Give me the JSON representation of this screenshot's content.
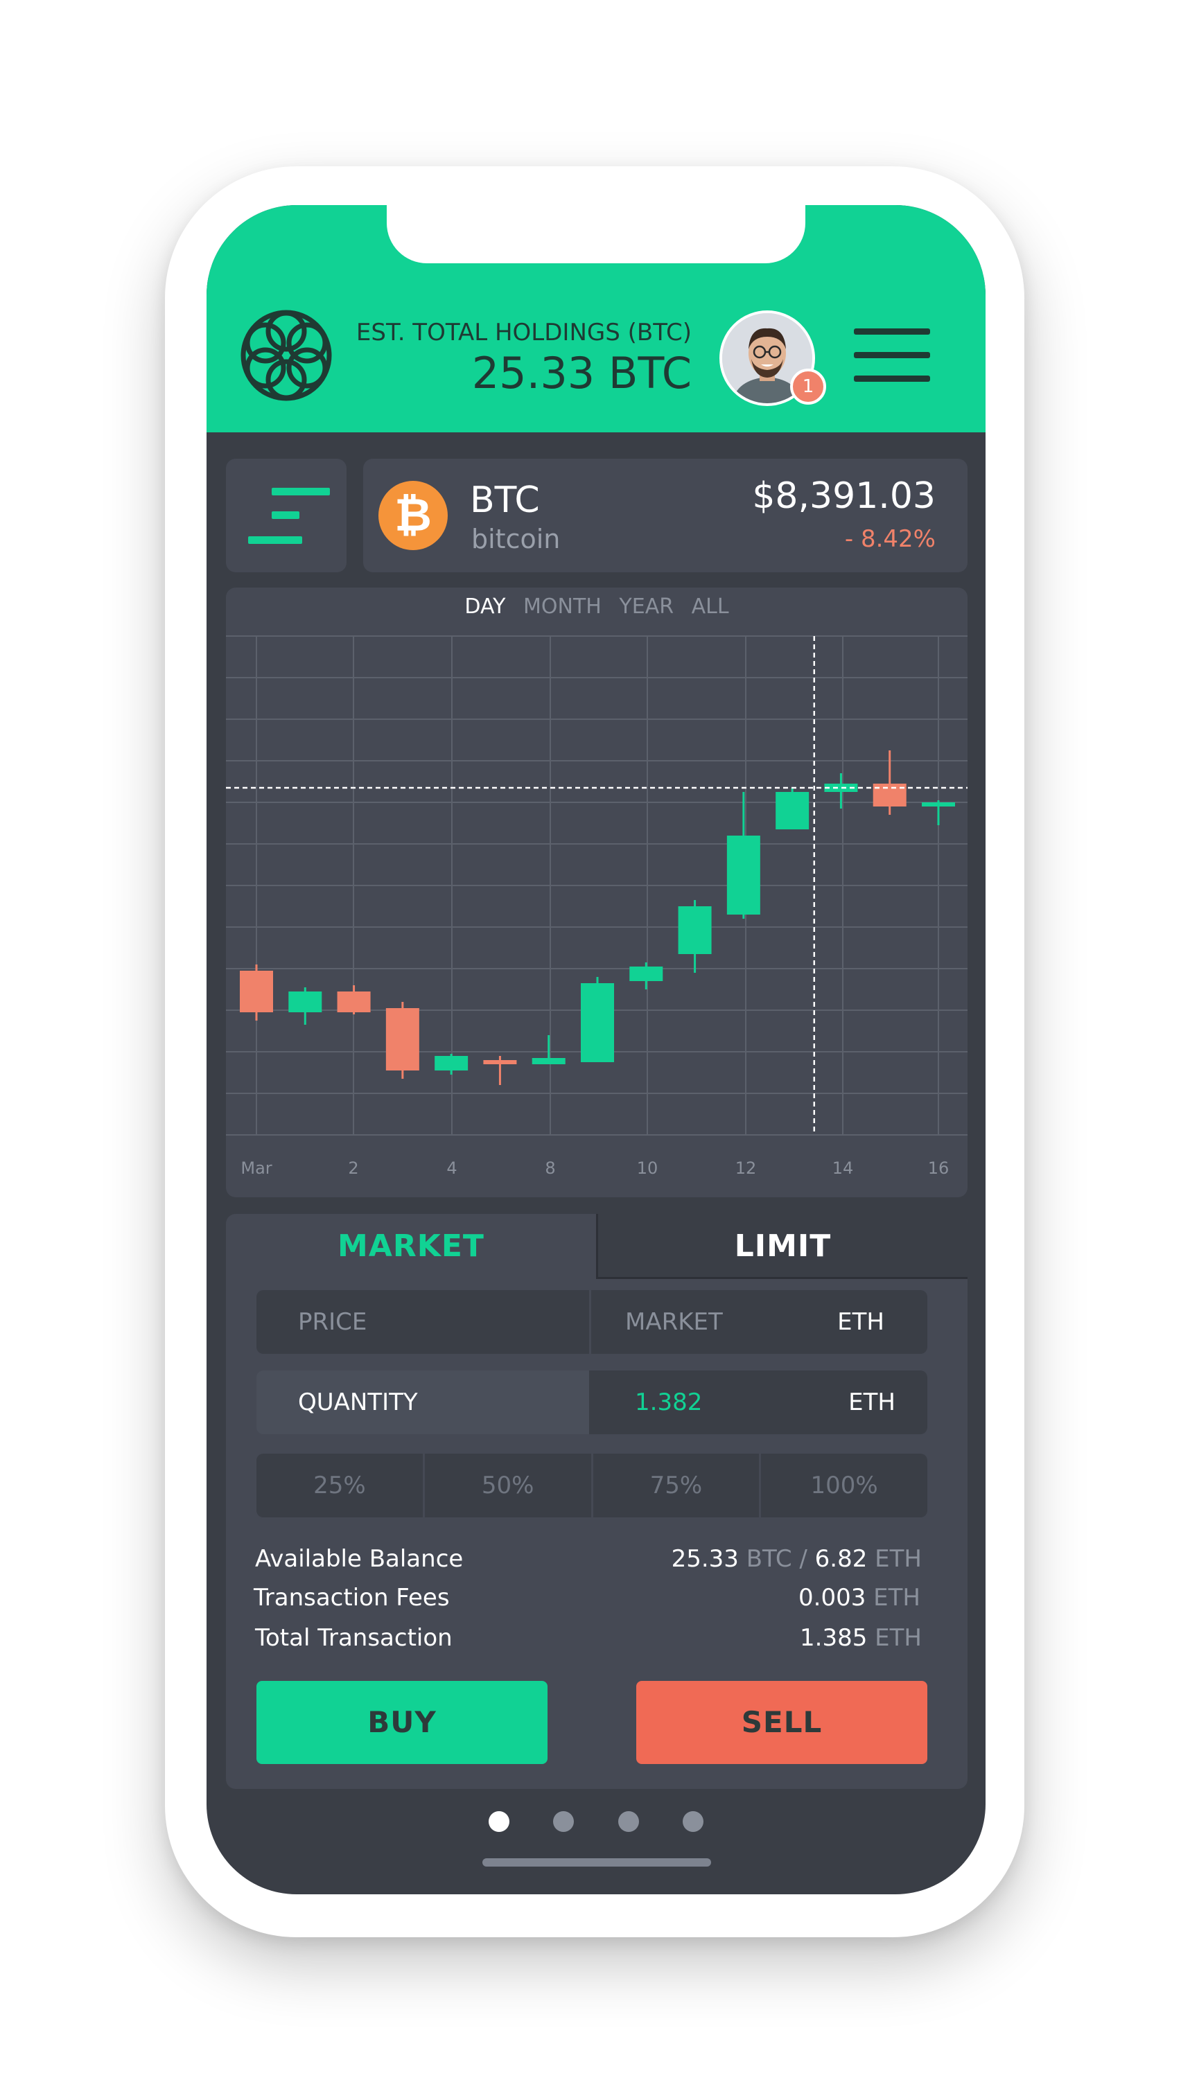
{
  "header": {
    "holdings_label": "EST. TOTAL HOLDINGS (BTC)",
    "holdings_value": "25.33 BTC",
    "notification_count": "1"
  },
  "coin": {
    "icon": "bitcoin-icon",
    "icon_glyph": "₿",
    "symbol": "BTC",
    "name": "bitcoin",
    "price": "$8,391.03",
    "change": "- 8.42%"
  },
  "range_tabs": [
    "DAY",
    "MONTH",
    "YEAR",
    "ALL"
  ],
  "active_range": "DAY",
  "chart_data": {
    "type": "candlestick",
    "x_tick_labels": [
      "Mar",
      "2",
      "4",
      "8",
      "10",
      "12",
      "14",
      "16"
    ],
    "candles": [
      {
        "open": 2.95,
        "close": 3.95,
        "high": 4.1,
        "low": 2.75,
        "direction": "down"
      },
      {
        "open": 2.95,
        "close": 3.45,
        "high": 3.55,
        "low": 2.65,
        "direction": "up"
      },
      {
        "open": 3.45,
        "close": 2.95,
        "high": 3.6,
        "low": 2.9,
        "direction": "down"
      },
      {
        "open": 3.05,
        "close": 1.55,
        "high": 3.2,
        "low": 1.35,
        "direction": "down"
      },
      {
        "open": 1.55,
        "close": 1.9,
        "high": 1.95,
        "low": 1.45,
        "direction": "up"
      },
      {
        "open": 1.8,
        "close": 1.7,
        "high": 1.9,
        "low": 1.2,
        "direction": "down"
      },
      {
        "open": 1.7,
        "close": 1.85,
        "high": 2.4,
        "low": 1.7,
        "direction": "up"
      },
      {
        "open": 1.75,
        "close": 3.65,
        "high": 3.8,
        "low": 1.75,
        "direction": "up"
      },
      {
        "open": 3.7,
        "close": 4.05,
        "high": 4.15,
        "low": 3.5,
        "direction": "up"
      },
      {
        "open": 4.35,
        "close": 5.5,
        "high": 5.65,
        "low": 3.9,
        "direction": "up"
      },
      {
        "open": 5.3,
        "close": 7.2,
        "high": 8.25,
        "low": 5.2,
        "direction": "up"
      },
      {
        "open": 7.35,
        "close": 8.25,
        "high": 8.35,
        "low": 7.35,
        "direction": "up"
      },
      {
        "open": 8.25,
        "close": 8.45,
        "high": 8.7,
        "low": 7.85,
        "direction": "up"
      },
      {
        "open": 8.45,
        "close": 7.9,
        "high": 9.25,
        "low": 7.7,
        "direction": "down"
      },
      {
        "open": 7.9,
        "close": 8.0,
        "high": 8.05,
        "low": 7.45,
        "direction": "up"
      }
    ],
    "grid": true,
    "colors": {
      "up": "#11d294",
      "down": "#f0826a"
    }
  },
  "trade": {
    "tabs": {
      "market": "MARKET",
      "limit": "LIMIT"
    },
    "price": {
      "label": "PRICE",
      "value": "MARKET",
      "unit": "ETH"
    },
    "quantity": {
      "label": "QUANTITY",
      "value": "1.382",
      "unit": "ETH"
    },
    "percentages": [
      "25%",
      "50%",
      "75%",
      "100%"
    ],
    "summary": {
      "available_label": "Available Balance",
      "available_btc": "25.33",
      "available_btc_unit": "BTC",
      "separator": "/",
      "available_eth": "6.82",
      "available_eth_unit": "ETH",
      "fees_label": "Transaction Fees",
      "fees_value": "0.003",
      "fees_unit": "ETH",
      "total_label": "Total Transaction",
      "total_value": "1.385",
      "total_unit": "ETH"
    },
    "buy_label": "BUY",
    "sell_label": "SELL"
  },
  "colors": {
    "accent": "#11d294",
    "sell": "#f06a55",
    "negative": "#f0826a",
    "bitcoin": "#f5943a",
    "surface": "#3a3e46",
    "card": "#454954"
  },
  "pagination": {
    "count": 4,
    "active": 0
  }
}
